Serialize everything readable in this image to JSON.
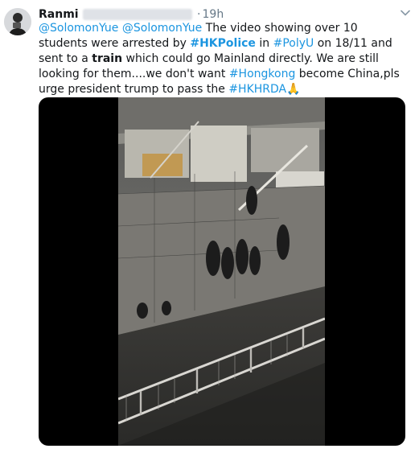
{
  "author": {
    "name": "Ranmi",
    "handle_redacted": true,
    "time": "19h",
    "separator": "·"
  },
  "icons": {
    "menu": "chevron-down-icon",
    "avatar": "avatar"
  },
  "tweet": {
    "seg_m1": "@SolomonYue",
    "seg_sp1": " ",
    "seg_m2": "@SolomonYue",
    "seg_t1": " The video showing over 10 students were arrested by ",
    "seg_h1": "#HKPolice",
    "seg_t2": " in ",
    "seg_h2": "#PolyU",
    "seg_t3": " on 18/11 and sent to a ",
    "seg_b1": "train",
    "seg_t4": " which could go Mainland directly. We are still looking for them....we don't want ",
    "seg_h3": "#Hongkong",
    "seg_t5": " become China,pls urge president trump to pass the ",
    "seg_h4": "#HKHRDA",
    "seg_emoji": "🙏"
  },
  "colors": {
    "link": "#1b95e0",
    "secondary": "#657786",
    "text": "#14171a"
  }
}
